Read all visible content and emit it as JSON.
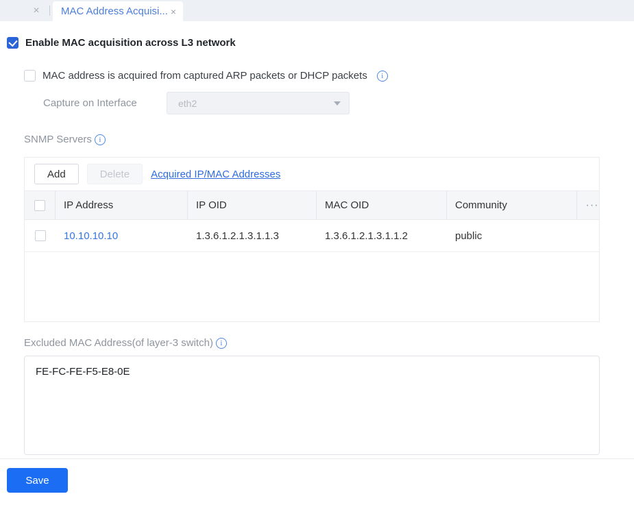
{
  "tab_bar": {
    "prev_close_icon": "×",
    "active_tab": {
      "label": "MAC Address Acquisi...",
      "close_icon": "×"
    }
  },
  "form": {
    "enable_checkbox": {
      "label": "Enable MAC acquisition across L3 network",
      "checked": true
    },
    "arp_checkbox": {
      "label": "MAC address is acquired from captured ARP packets or DHCP packets",
      "checked": false
    },
    "capture_interface": {
      "label": "Capture on Interface",
      "value": "eth2",
      "disabled": true
    },
    "snmp": {
      "label": "SNMP Servers",
      "toolbar": {
        "add_label": "Add",
        "delete_label": "Delete",
        "link_label": "Acquired IP/MAC Addresses"
      },
      "table": {
        "columns": [
          "IP Address",
          "IP OID",
          "MAC OID",
          "Community"
        ],
        "more_icon": "···",
        "rows": [
          {
            "ip": "10.10.10.10",
            "ip_oid": "1.3.6.1.2.1.3.1.1.3",
            "mac_oid": "1.3.6.1.2.1.3.1.1.2",
            "community": "public"
          }
        ]
      }
    },
    "excluded_mac": {
      "label": "Excluded MAC Address(of layer-3 switch)",
      "value": "FE-FC-FE-F5-E8-0E"
    },
    "save_label": "Save"
  },
  "colors": {
    "accent_blue": "#1b6ef3",
    "checkbox_blue": "#2b63d9",
    "link_blue": "#2e6ce0",
    "tab_text_blue": "#4c7fd9",
    "info_blue": "#4a86e8",
    "label_gray": "#8e959e",
    "tabbar_bg": "#edf0f5",
    "table_header_bg": "#f5f6f8",
    "border_gray": "#e9ebef"
  }
}
